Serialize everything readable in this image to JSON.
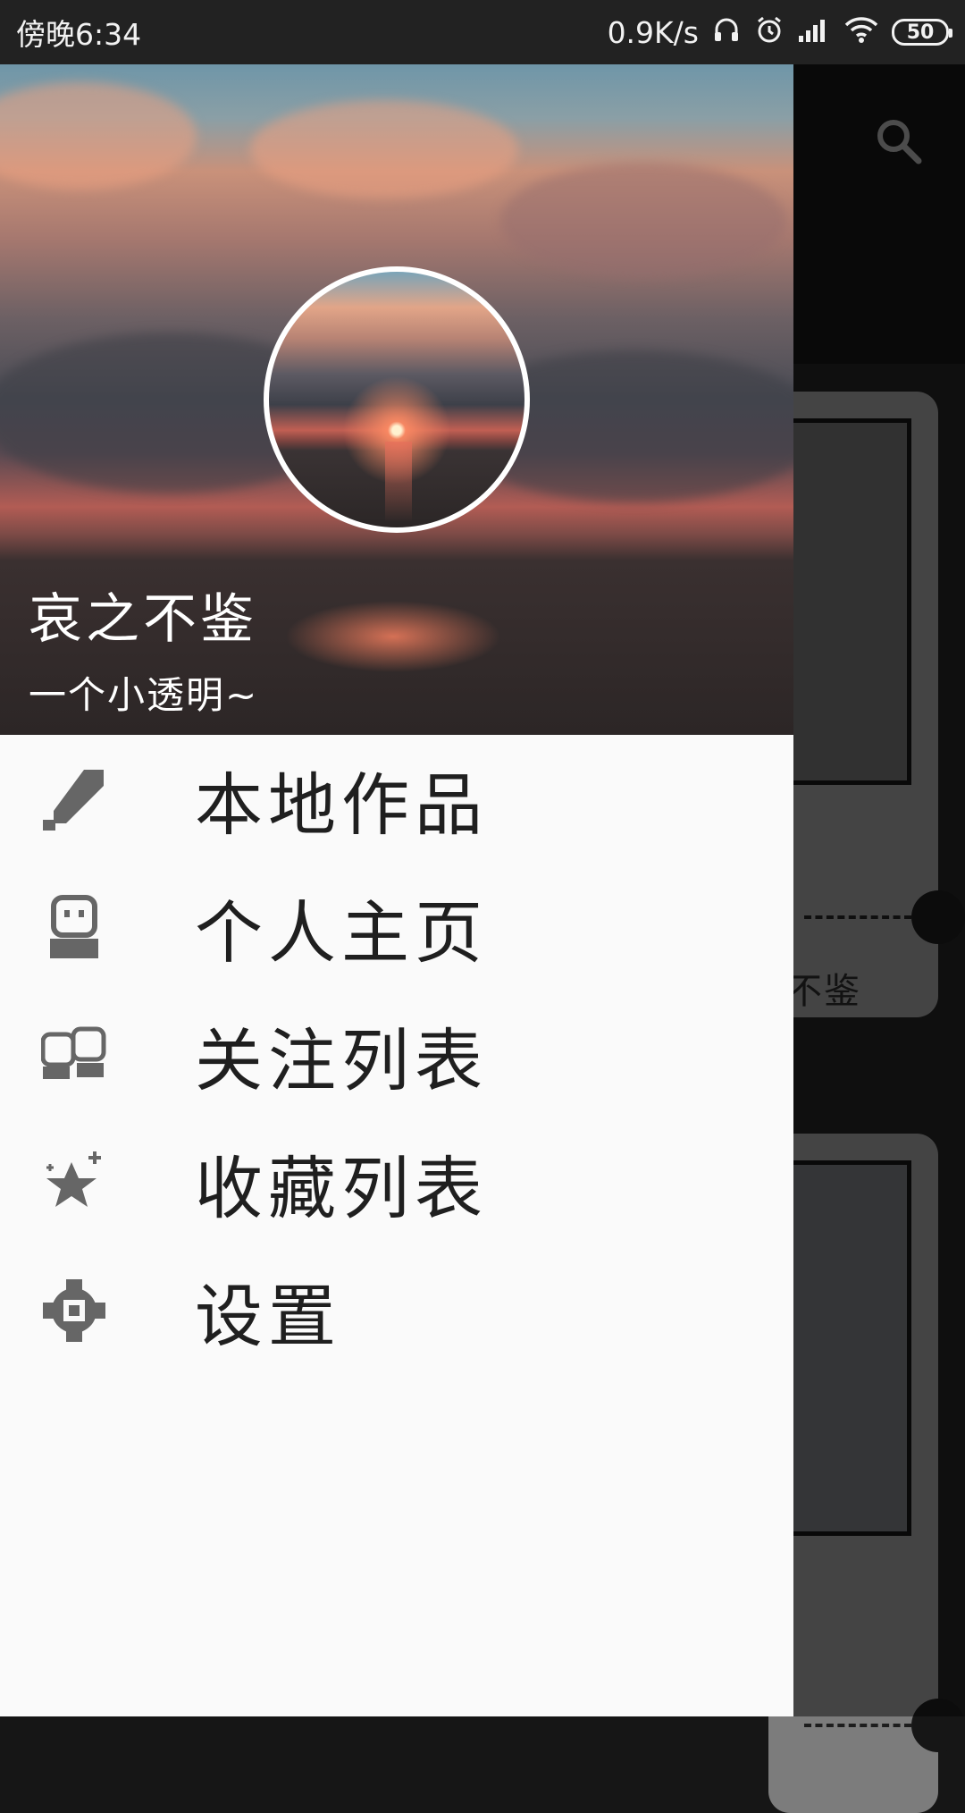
{
  "status_bar": {
    "time": "傍晚6:34",
    "net_speed": "0.9K/s",
    "battery": "50",
    "icons": [
      "headphones-icon",
      "alarm-icon",
      "signal-icon",
      "wifi-icon",
      "battery-icon"
    ]
  },
  "background_app": {
    "search_icon": "search-icon",
    "card_text": "不鉴"
  },
  "drawer": {
    "username": "哀之不鉴",
    "tagline": "一个小透明~",
    "menu": [
      {
        "label": "本地作品",
        "icon": "pencil-icon"
      },
      {
        "label": "个人主页",
        "icon": "person-icon"
      },
      {
        "label": "关注列表",
        "icon": "people-icon"
      },
      {
        "label": "收藏列表",
        "icon": "star-icon"
      },
      {
        "label": "设置",
        "icon": "gear-icon"
      }
    ]
  }
}
